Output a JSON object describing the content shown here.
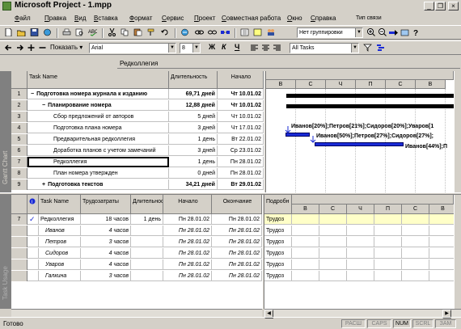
{
  "app": {
    "title": "Microsoft Project - 1.mpp",
    "window_buttons": [
      "_",
      "❐",
      "×"
    ]
  },
  "menu": [
    "Файл",
    "Правка",
    "Вид",
    "Вставка",
    "Формат",
    "Сервис",
    "Проект",
    "Совместная работа",
    "Окно",
    "Справка",
    "Тип связи"
  ],
  "toolbar": {
    "grouping": "Нет группировки",
    "show_label": "Показать",
    "font": "Arial",
    "font_size": "8",
    "format_b": "Ж",
    "format_i": "К",
    "format_u": "Ч",
    "filter": "All Tasks"
  },
  "entry_bar": {
    "value": "Редколлегия"
  },
  "top_view": {
    "side_label": "Gantt Chart",
    "columns": [
      "Task Name",
      "Длительность",
      "Начало"
    ],
    "rows": [
      {
        "id": "1",
        "name": "Подготовка номера журнала к изданию",
        "duration": "69,71 дней",
        "start": "Чт 10.01.02",
        "level": 0,
        "summary": true,
        "sign": "−"
      },
      {
        "id": "2",
        "name": "Планирование номера",
        "duration": "12,88 дней",
        "start": "Чт 10.01.02",
        "level": 1,
        "summary": true,
        "sign": "−"
      },
      {
        "id": "3",
        "name": "Сбор предложений от авторов",
        "duration": "5 дней",
        "start": "Чт 10.01.02",
        "level": 2
      },
      {
        "id": "4",
        "name": "Подготовка плана номера",
        "duration": "3 дней",
        "start": "Чт 17.01.02",
        "level": 2
      },
      {
        "id": "5",
        "name": "Предварительная редколлегия",
        "duration": "1 день",
        "start": "Вт 22.01.02",
        "level": 2
      },
      {
        "id": "6",
        "name": "Доработка планов с учетом замечаний",
        "duration": "3 дней",
        "start": "Ср 23.01.02",
        "level": 2
      },
      {
        "id": "7",
        "name": "Редколлегия",
        "duration": "1 день",
        "start": "Пн 28.01.02",
        "level": 2,
        "selected": true
      },
      {
        "id": "8",
        "name": "План номера утвержден",
        "duration": "0 дней",
        "start": "Пн 28.01.02",
        "level": 2
      },
      {
        "id": "9",
        "name": "Подготовка текстов",
        "duration": "34,21 дней",
        "start": "Вт 29.01.02",
        "level": 1,
        "summary": true,
        "sign": "+"
      }
    ],
    "timescale_days": [
      "В",
      "С",
      "Ч",
      "П",
      "С",
      "В"
    ],
    "bar_labels": [
      "Иванов[20%];Петров[21%];Сидоров[20%];Уваров[1",
      "Иванов[50%];Петров[27%];Сидоров[27%];",
      "Иванов[44%];П"
    ]
  },
  "bottom_view": {
    "side_label": "Task Usage",
    "columns": [
      "Task Name",
      "Трудозатраты",
      "Длительность",
      "Начало",
      "Окончание",
      "Подробн"
    ],
    "rows": [
      {
        "id": "7",
        "name": "Редколлегия",
        "work": "18 часов",
        "duration": "1 день",
        "start": "Пн 28.01.02",
        "finish": "Пн 28.01.02",
        "detail": "Трудоз",
        "check": "✓"
      },
      {
        "name": "Иванов",
        "work": "4 часов",
        "start": "Пн 28.01.02",
        "finish": "Пн 28.01.02",
        "detail": "Трудоз"
      },
      {
        "name": "Петров",
        "work": "3 часов",
        "start": "Пн 28.01.02",
        "finish": "Пн 28.01.02",
        "detail": "Трудоз"
      },
      {
        "name": "Сидоров",
        "work": "4 часов",
        "start": "Пн 28.01.02",
        "finish": "Пн 28.01.02",
        "detail": "Трудоз"
      },
      {
        "name": "Уваров",
        "work": "4 часов",
        "start": "Пн 28.01.02",
        "finish": "Пн 28.01.02",
        "detail": "Трудоз"
      },
      {
        "name": "Галкина",
        "work": "3 часов",
        "start": "Пн 28.01.02",
        "finish": "Пн 28.01.02",
        "detail": "Трудоз"
      }
    ],
    "timescale_days": [
      "В",
      "С",
      "Ч",
      "П",
      "С",
      "В"
    ]
  },
  "status": {
    "text": "Готово",
    "indicators": [
      "РАСШ",
      "CAPS",
      "NUM",
      "SCRL",
      "ЗАМ"
    ],
    "active_indicator": "NUM"
  },
  "colors": {
    "bar": "#1a2bd6",
    "summary": "#000000",
    "highlight": "#ffffc8"
  }
}
